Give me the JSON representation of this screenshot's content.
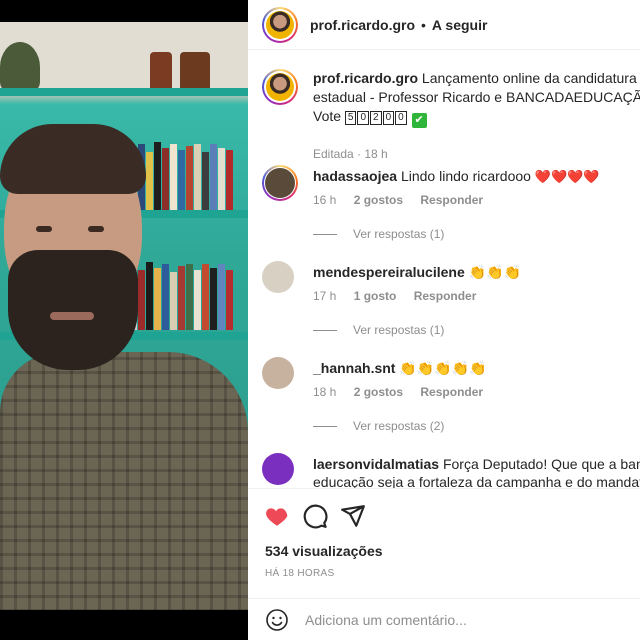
{
  "header": {
    "username": "prof.ricardo.gro",
    "separator": "•",
    "follow_label": "A seguir"
  },
  "caption": {
    "username": "prof.ricardo.gro",
    "text_line1": "Lançamento online da candidatura a d",
    "text_line2": "estadual - Professor Ricardo e BANCADAEDUCAÇÃO",
    "vote_label": "Vote",
    "vote_digits": [
      "5",
      "0",
      "2",
      "0",
      "0"
    ],
    "check_glyph": "✔",
    "meta": "Editada · 18 h"
  },
  "comments": [
    {
      "username": "hadassaojea",
      "text": "Lindo lindo ricardooo",
      "hearts": "❤️❤️❤️❤️",
      "time": "16 h",
      "likes": "2 gostos",
      "reply_label": "Responder",
      "view_replies": "Ver respostas (1)"
    },
    {
      "username": "mendespereiralucilene",
      "text": "",
      "emoji": "👏👏👏",
      "time": "17 h",
      "likes": "1 gosto",
      "reply_label": "Responder",
      "view_replies": "Ver respostas (1)"
    },
    {
      "username": "_hannah.snt",
      "text": "",
      "emoji": "👏👏👏👏👏",
      "time": "18 h",
      "likes": "2 gostos",
      "reply_label": "Responder",
      "view_replies": "Ver respostas (2)"
    },
    {
      "username": "laersonvidalmatias",
      "text_line1": "Força Deputado! Que que a bancad",
      "text_line2": "educação seja a fortaleza da campanha e do mandato"
    }
  ],
  "actions": {
    "like_icon": "heart-filled-icon",
    "comment_icon": "comment-icon",
    "share_icon": "send-icon",
    "views": "534 visualizações",
    "time_ago": "HÁ 18 HORAS"
  },
  "add_comment": {
    "emoji_icon": "smiley-icon",
    "placeholder": "Adiciona um comentário..."
  },
  "colors": {
    "like_red": "#ed4956",
    "text": "#262626",
    "muted": "#8e8e8e",
    "teal_shelf": "#1fa393"
  }
}
